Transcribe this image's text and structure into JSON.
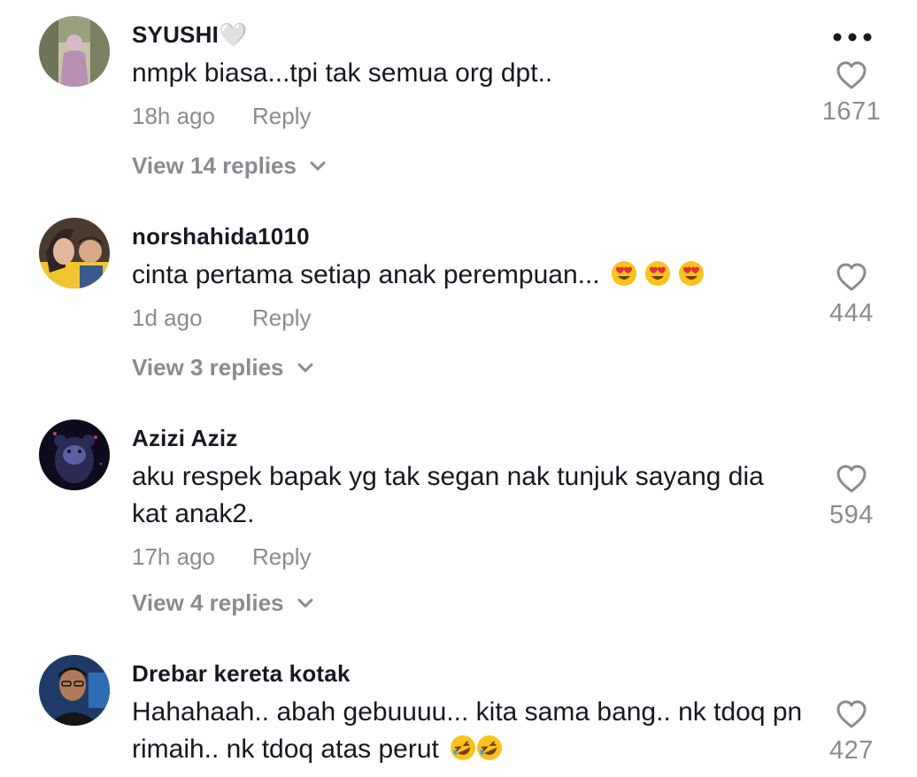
{
  "comments": [
    {
      "username": "SYUSHI🤍",
      "text": "nmpk biasa...tpi tak semua org dpt..",
      "time": "18h ago",
      "reply": "Reply",
      "likes": "1671",
      "view_replies": "View 14 replies"
    },
    {
      "username": "norshahida1010",
      "text": "cinta pertama setiap anak perempuan...",
      "time": "1d ago",
      "reply": "Reply",
      "likes": "444",
      "view_replies": "View 3 replies"
    },
    {
      "username": "Azizi Aziz",
      "text": "aku respek bapak yg tak segan nak tunjuk sayang dia kat anak2.",
      "time": "17h ago",
      "reply": "Reply",
      "likes": "594",
      "view_replies": "View 4 replies"
    },
    {
      "username": "Drebar kereta kotak",
      "text": "Hahahaah.. abah gebuuuu... kita sama bang.. nk tdoq pn rimaih.. nk tdoq atas perut",
      "likes": "427"
    }
  ],
  "icons": {
    "more": "more-horizontal-icon",
    "like": "heart-outline-icon",
    "expand": "chevron-down-icon",
    "emoji_heart_eyes": "heart-eyes-emoji",
    "emoji_rofl": "rofl-emoji"
  },
  "colors": {
    "text": "#161823",
    "secondary": "#8a8b91",
    "background": "#ffffff"
  }
}
